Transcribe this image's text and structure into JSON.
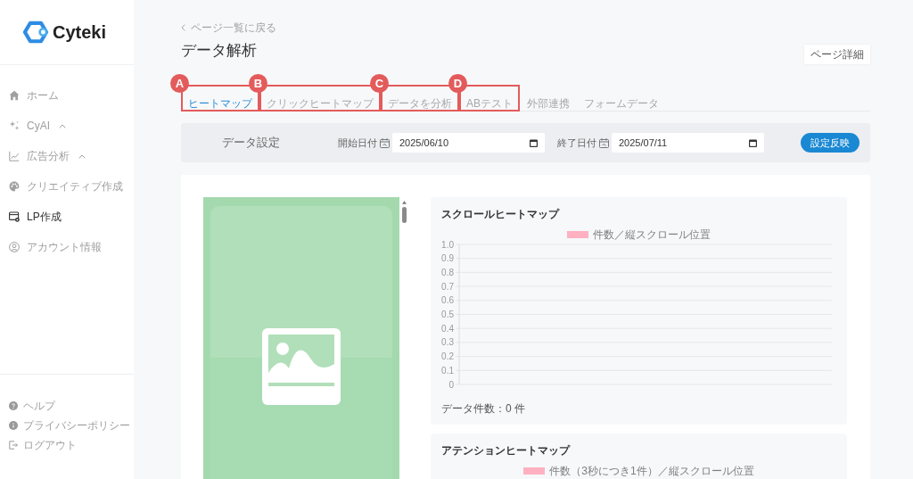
{
  "sidebar": {
    "logo": "Cyteki",
    "nav_items": [
      {
        "label": "ホーム",
        "kind": "link",
        "selected": false
      },
      {
        "label": "CyAI",
        "kind": "group",
        "selected": false
      },
      {
        "label": "広告分析",
        "kind": "group",
        "selected": false
      },
      {
        "label": "クリエイティブ作成",
        "kind": "link",
        "selected": false
      },
      {
        "label": "LP作成",
        "kind": "link",
        "selected": true
      },
      {
        "label": "アカウント情報",
        "kind": "link",
        "selected": false
      }
    ],
    "footer_items": [
      {
        "label": "ヘルプ"
      },
      {
        "label": "プライバシーポリシー"
      },
      {
        "label": "ログアウト"
      }
    ]
  },
  "header": {
    "back_link": "ページ一覧に戻る",
    "title": "データ解析",
    "detail_button": "ページ詳細"
  },
  "tabs": [
    {
      "label": "ヒートマップ",
      "selected": true,
      "callout": "A"
    },
    {
      "label": "クリックヒートマップ",
      "selected": false,
      "callout": "B"
    },
    {
      "label": "データを分析",
      "selected": false,
      "callout": "C"
    },
    {
      "label": "ABテスト",
      "selected": false,
      "callout": "D"
    },
    {
      "label": "外部連携",
      "selected": false
    },
    {
      "label": "フォームデータ",
      "selected": false
    }
  ],
  "data_settings": {
    "title": "データ設定",
    "start_label": "開始日付",
    "start_date": "2025/06/10",
    "end_label": "終了日付",
    "end_date": "2025/07/11",
    "apply_button": "設定反映"
  },
  "charts": [
    {
      "title": "スクロールヒートマップ",
      "chart_data": {
        "type": "bar",
        "grid": true,
        "ylim": [
          0,
          1
        ],
        "yticks": [
          0,
          0.1,
          0.2,
          0.3,
          0.4,
          0.5,
          0.6,
          0.7,
          0.8,
          0.9,
          {
            "value": 1,
            "label": "1.0"
          }
        ],
        "series": [
          {
            "name": "件数／縦スクロール位置",
            "color": "#ffb1c1"
          }
        ]
      },
      "footer": "データ件数：0 件"
    },
    {
      "title": "アテンションヒートマップ",
      "legend": [
        {
          "label": "件数（3秒につき1件）／縦スクロール位置",
          "color": "#ffb1c1"
        }
      ]
    }
  ]
}
